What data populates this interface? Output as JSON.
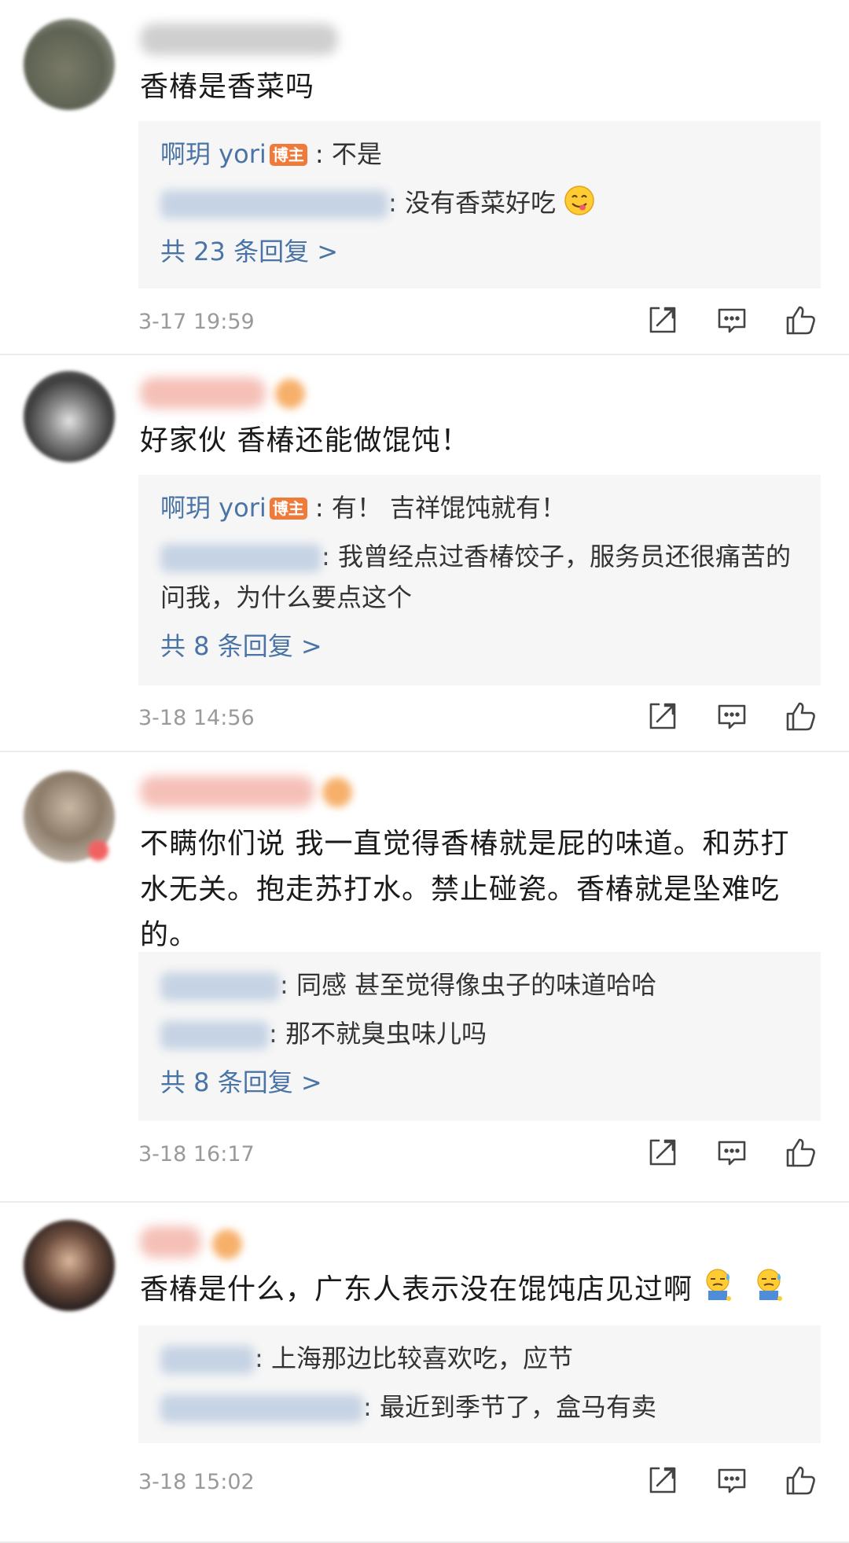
{
  "reply_suffix": ":",
  "comments": [
    {
      "text": "香椿是香菜吗",
      "replies": [
        {
          "name": "啊玥 yori",
          "is_author": true,
          "author_badge": "博主",
          "text": ": 不是"
        },
        {
          "name_hidden": true,
          "text": ": 没有香菜好吃"
        }
      ],
      "more": "共 23 条回复 >",
      "time": "3-17 19:59"
    },
    {
      "text": "好家伙 香椿还能做馄饨！",
      "replies": [
        {
          "name": "啊玥 yori",
          "is_author": true,
          "author_badge": "博主",
          "text": ": 有！ 吉祥馄饨就有！"
        },
        {
          "name_hidden": true,
          "text": ": 我曾经点过香椿饺子，服务员还很痛苦的问我，为什么要点这个"
        }
      ],
      "more": "共 8 条回复 >",
      "time": "3-18 14:56"
    },
    {
      "text": "不瞒你们说 我一直觉得香椿就是屁的味道。和苏打水无关。抱走苏打水。禁止碰瓷。香椿就是坠难吃的。",
      "replies": [
        {
          "name_hidden": true,
          "text": ": 同感 甚至觉得像虫子的味道哈哈"
        },
        {
          "name_hidden": true,
          "text": ": 那不就臭虫味儿吗"
        }
      ],
      "more": "共 8 条回复 >",
      "time": "3-18 16:17"
    },
    {
      "text": "香椿是什么，广东人表示没在馄饨店见过啊",
      "replies": [
        {
          "name_hidden": true,
          "text": ": 上海那边比较喜欢吃，应节"
        },
        {
          "name_hidden": true,
          "text": ": 最近到季节了，盒马有卖"
        }
      ],
      "time": "3-18 15:02"
    }
  ],
  "icons": {
    "share": "share-icon",
    "comment": "comment-icon",
    "like": "like-icon",
    "emoji_yum": "emoji-yum-icon",
    "emoji_sweat": "emoji-sweat-icon"
  },
  "colors": {
    "link": "#4a74a5",
    "author_badge": "#f07a3a",
    "reply_bg": "#f6f6f6",
    "time": "#9a9a9a"
  }
}
